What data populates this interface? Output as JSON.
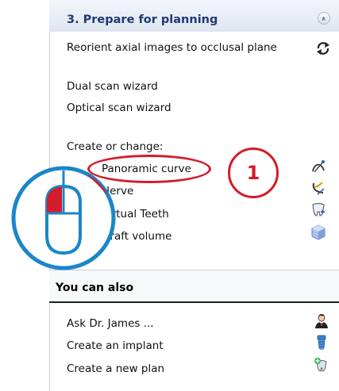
{
  "section": {
    "title": "3. Prepare for planning",
    "collapse_glyph": "»",
    "reorient_label": "Reorient axial images to occlusal plane",
    "dual_scan_label": "Dual scan wizard",
    "optical_scan_label": "Optical scan wizard",
    "create_or_change_label": "Create or change:",
    "items": [
      {
        "label": "Panoramic curve",
        "icon": "panoramic-curve-icon"
      },
      {
        "label": "Nerve",
        "icon": "nerve-icon"
      },
      {
        "label": "Virtual Teeth",
        "icon": "virtual-teeth-icon"
      },
      {
        "label": "Graft volume",
        "icon": "graft-volume-icon"
      }
    ]
  },
  "you_can_also": {
    "title": "You can also",
    "items": [
      {
        "label": "Ask Dr. James ...",
        "icon": "dr-james-icon"
      },
      {
        "label": "Create an implant",
        "icon": "implant-icon"
      },
      {
        "label": "Create a new plan",
        "icon": "new-plan-icon"
      }
    ]
  },
  "callout": {
    "number": "1",
    "color": "#d31c2a",
    "mouse_color": "#1b86c8"
  }
}
